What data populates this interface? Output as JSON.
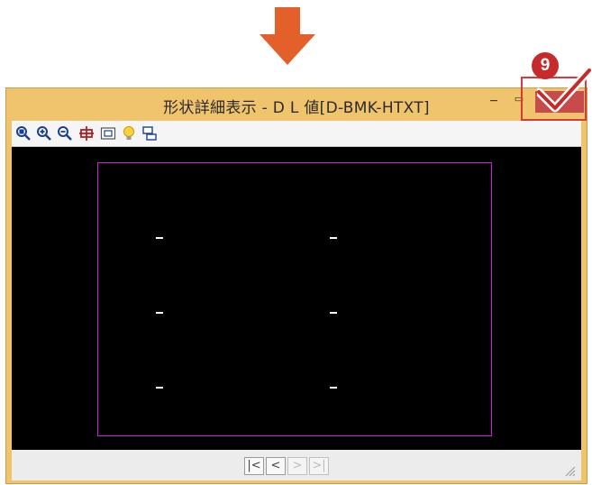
{
  "window": {
    "title": "形状詳細表示 - D L 値[D-BMK-HTXT]",
    "minimize_label": "−",
    "maximize_label": "▭",
    "close_label": "×"
  },
  "toolbar": {
    "icons": [
      "zoom-fit-icon",
      "zoom-in-icon",
      "zoom-out-icon",
      "pan-icon",
      "reset-view-icon",
      "lightbulb-icon",
      "network-icon"
    ]
  },
  "canvas": {
    "marks": [
      "-",
      "-",
      "-",
      "-",
      "-",
      "-"
    ]
  },
  "navigation": {
    "first_label": "|<",
    "prev_label": "<",
    "next_label": ">",
    "last_label": ">|"
  },
  "callout": {
    "step_number": "9"
  },
  "colors": {
    "title_bar": "#f0c36d",
    "close_button": "#c74b4b",
    "canvas_bg": "#000000",
    "frame": "#d01fd6",
    "arrow": "#e4602a",
    "callout": "#c72a2a"
  }
}
